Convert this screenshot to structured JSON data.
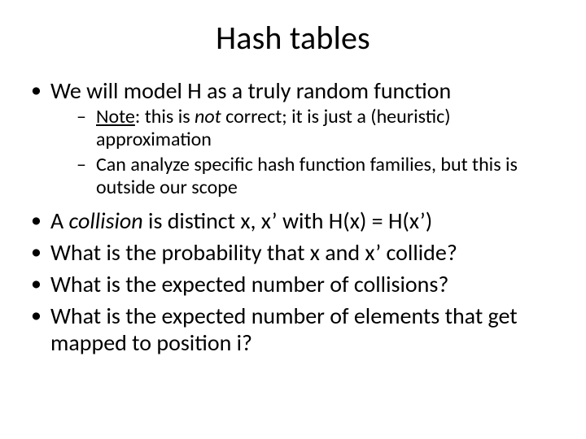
{
  "title": "Hash tables",
  "bullets": {
    "b1_pre": "We will model H as a truly random function",
    "sub1_pre": "Note",
    "sub1_mid": ": this is ",
    "sub1_not": "not",
    "sub1_post": " correct; it is just a (heuristic) approximation",
    "sub2": "Can analyze specific hash function families, but this is outside our scope",
    "b2_pre": "A ",
    "b2_collision": "collision",
    "b2_post": " is distinct x, x’ with H(x) = H(x’)",
    "b3": "What is the probability that x and x’ collide?",
    "b4": "What is the expected number of collisions?",
    "b5": "What is the expected number of elements that get mapped to position i?"
  }
}
